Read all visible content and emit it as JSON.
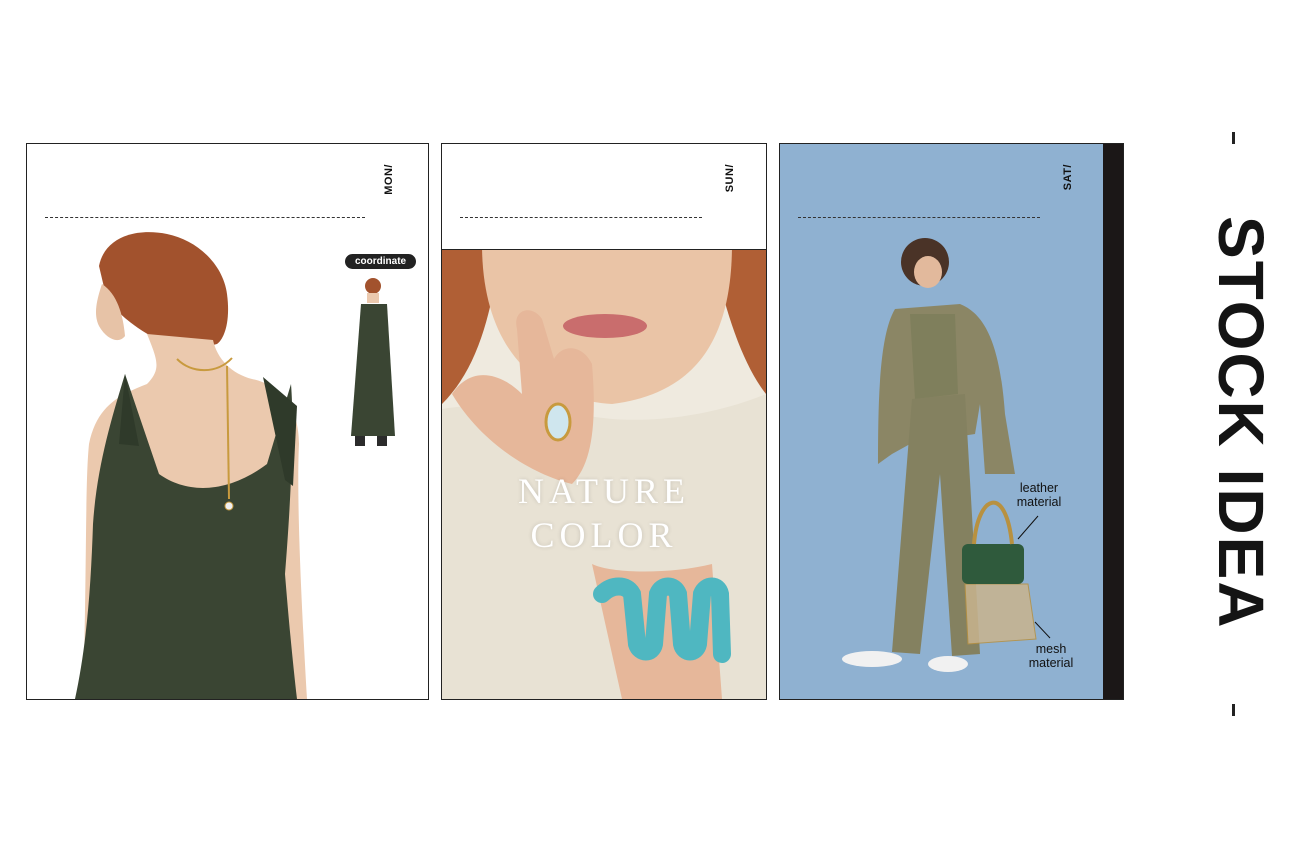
{
  "panels": [
    {
      "day": "MON/",
      "badge": "coordinate"
    },
    {
      "day": "SUN/",
      "headline_line1": "NATURE",
      "headline_line2": "COLOR"
    },
    {
      "day": "SAT/",
      "callout_top_line1": "leather",
      "callout_top_line2": "material",
      "callout_bottom_line1": "mesh",
      "callout_bottom_line2": "material",
      "background_color": "#8fb1d1"
    }
  ],
  "side_title": "STOCK IDEA"
}
